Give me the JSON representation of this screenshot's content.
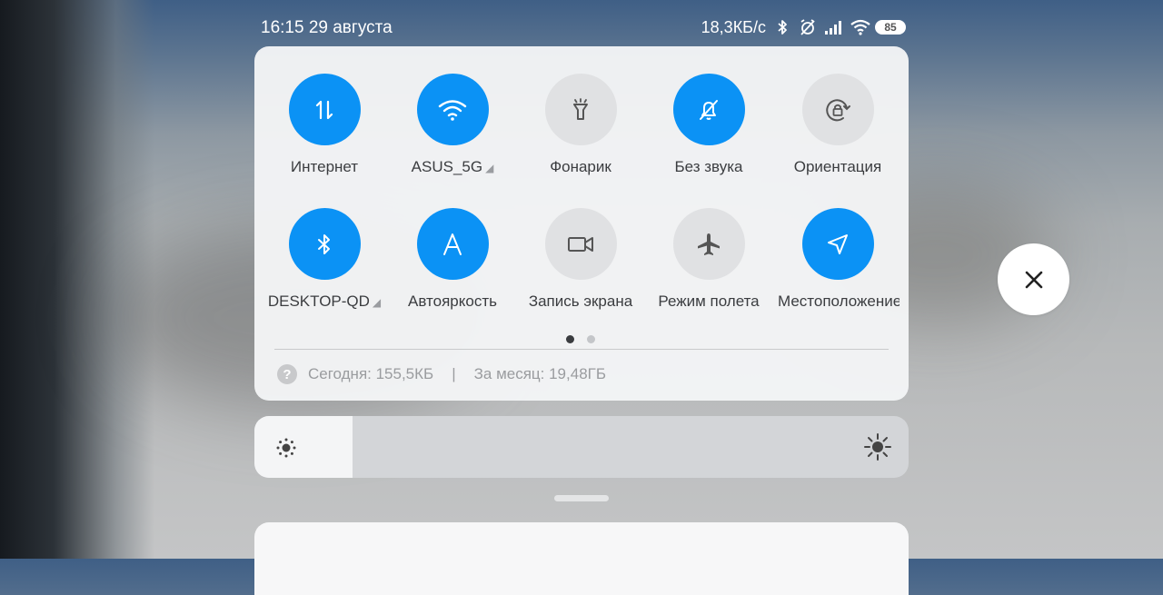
{
  "status_bar": {
    "time_date": "16:15 29 августа",
    "net_speed": "18,3КБ/с",
    "battery": "85",
    "icons": [
      "bluetooth-icon",
      "alarm-off-icon",
      "signal-icon",
      "wifi-icon",
      "battery-icon"
    ]
  },
  "quick_settings": {
    "tiles": [
      {
        "label": "Интернет",
        "icon": "data-transfer-icon",
        "state": "on"
      },
      {
        "label": "ASUS_5G",
        "icon": "wifi-icon",
        "state": "on",
        "expand": "◢"
      },
      {
        "label": "Фонарик",
        "icon": "flashlight-icon",
        "state": "off"
      },
      {
        "label": "Без звука",
        "icon": "bell-off-icon",
        "state": "on"
      },
      {
        "label": "Ориентация",
        "icon": "rotation-lock-icon",
        "state": "off"
      },
      {
        "label": "DESKTOP-QD",
        "icon": "bluetooth-icon",
        "state": "on",
        "expand": "◢"
      },
      {
        "label": "Автояркость",
        "icon": "auto-brightness-icon",
        "state": "on"
      },
      {
        "label": "Запись экрана",
        "icon": "screen-record-icon",
        "state": "off"
      },
      {
        "label": "Режим полета",
        "icon": "airplane-icon",
        "state": "off"
      },
      {
        "label": "Местоположение",
        "icon": "location-icon",
        "state": "on"
      }
    ],
    "pages": {
      "current": 1,
      "total": 2
    },
    "data_usage": {
      "help_icon": "?",
      "today": "Сегодня: 155,5КБ",
      "separator": "|",
      "month": "За месяц: 19,48ГБ"
    }
  },
  "brightness": {
    "level": 0.15,
    "low_icon": "brightness-low-icon",
    "high_icon": "brightness-high-icon"
  },
  "close_button": {
    "icon": "close-icon"
  },
  "colors": {
    "accent": "#0b92f5",
    "tile_off": "#e0e1e3",
    "panel": "#f4f5f6"
  }
}
